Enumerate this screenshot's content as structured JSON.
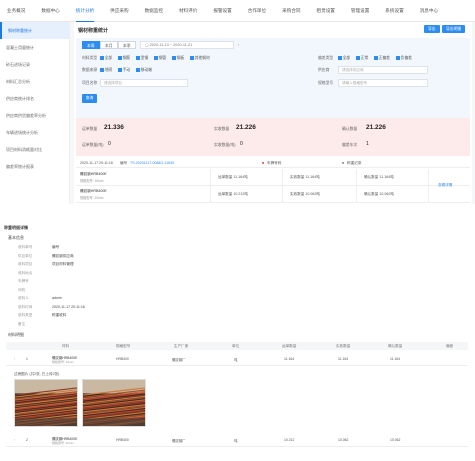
{
  "topnav": [
    "业务概况",
    "数据中心",
    "统计分析",
    "供应采购",
    "数据监控",
    "材料评价",
    "报警设置",
    "合作单位",
    "采购合同",
    "租赁设置",
    "管理设置",
    "系统设置",
    "消息中心"
  ],
  "sidebar": [
    "钢材称重统计",
    "混凝土用量统计",
    "砂石进场记录",
    "材料汇总分析",
    "供应商统计排名",
    "供应商供货偏差率分析",
    "车辆进场统计分析",
    "项目材料消耗量对比",
    "偏差率统计报表"
  ],
  "page": {
    "title": "钢材称重统计",
    "print_btn": "导出",
    "export_btn": "导出明细",
    "segs": [
      "本周",
      "本月",
      "本季"
    ],
    "date_start": "2020-11-13",
    "date_end": "2020-11-21",
    "material_label": "材料类型",
    "materials": [
      "全部",
      "钢筋",
      "型钢",
      "钢管",
      "钢板",
      "其他钢材"
    ],
    "stat_label": "偏差类型",
    "stats": [
      "全部",
      "正常",
      "正偏差",
      "负偏差"
    ],
    "supplier_label": "供应商",
    "supplier_ph": "请选择供应商",
    "source_label": "数据来源",
    "sources": [
      "地磅",
      "手动",
      "移动端"
    ],
    "project_label": "项目名称",
    "project_ph": "请选择项目",
    "spec_label": "规格型号",
    "spec_ph": "请输入规格型号",
    "query_btn": "查询"
  },
  "summary": {
    "l1": "运单数量",
    "v1": "21.336",
    "l2": "实收数量",
    "v2": "21.226",
    "l3": "确认数量",
    "v3": "21.226",
    "l4": "运单数量(吨)",
    "v4": "0",
    "l5": "实收数量(吨)",
    "v5": "0",
    "l6": "偏差车次",
    "v6": "1"
  },
  "group": {
    "date": "2020-11-17 20:11:16",
    "no": "编号",
    "no_val": "TS-20201117-0084G-11630",
    "vehicle": "车牌号码",
    "weigh": "称重记录",
    "rows": [
      {
        "name": "螺纹钢HRB400E",
        "spec": "规格型号: 16mm",
        "c1": "运单数量 11.164吨",
        "c2": "实收数量 11.164吨",
        "c3": "确认数量 11.164吨",
        "link": "查看详情"
      },
      {
        "name": "螺纹钢HRB400E",
        "spec": "规格型号: 20mm",
        "c1": "运单数量 10.212吨",
        "c2": "实收数量 10.062吨",
        "c3": "确认数量 10.062吨",
        "link": ""
      }
    ]
  },
  "detail": {
    "title": "称重明细详情",
    "basic": "基本信息",
    "fields": [
      {
        "k": "收料单号",
        "v": "编号"
      },
      {
        "k": "供应单位",
        "v": "螺纹钢供应商"
      },
      {
        "k": "收料项目",
        "v": "项目材料管理"
      },
      {
        "k": "收料地点",
        "v": ""
      },
      {
        "k": "车牌号",
        "v": ""
      },
      {
        "k": "司机",
        "v": ""
      },
      {
        "k": "收料人",
        "v": "admin"
      },
      {
        "k": "收料时间",
        "v": "2020-11-17 20:11:16"
      },
      {
        "k": "收料类型",
        "v": "称重收料"
      },
      {
        "k": "备注",
        "v": ""
      }
    ],
    "materials_title": "材料明细",
    "headers": [
      "材料",
      "规格型号",
      "生产厂家",
      "单位",
      "运单数量",
      "实收数量",
      "确认数量",
      "偏差"
    ],
    "rows": [
      {
        "idx": "1",
        "name": "螺纹钢HRB400E",
        "spec": "HRB400",
        "sub": "规格型号: 16mm",
        "vendor": "螺纹钢厂",
        "unit": "吨",
        "q1": "11.164",
        "q2": "11.164",
        "q3": "11.164"
      },
      {
        "idx": "2",
        "name": "螺纹钢HRB400E",
        "spec": "HRB400",
        "sub": "规格型号: 20mm",
        "vendor": "螺纹钢厂",
        "unit": "吨",
        "q1": "10.212",
        "q2": "10.062",
        "q3": "10.062"
      }
    ],
    "photo_caption": "过磅图片 (共2张, 已上传2张)"
  }
}
